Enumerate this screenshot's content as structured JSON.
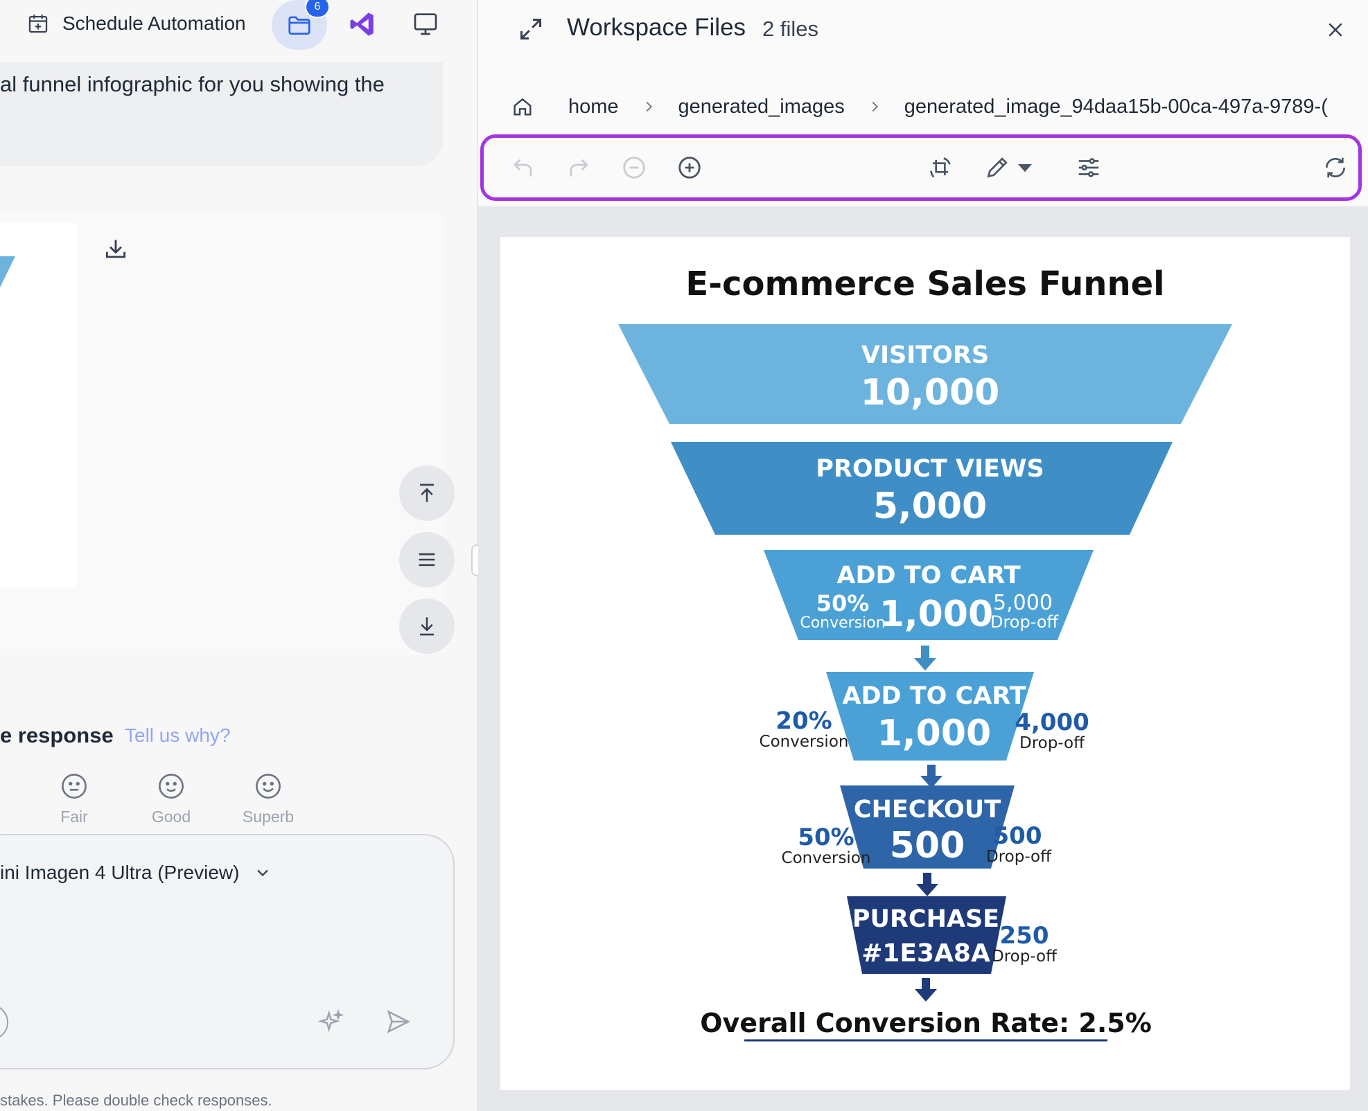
{
  "header": {
    "schedule_label": "Schedule Automation",
    "files_badge": "6"
  },
  "chat": {
    "message_fragment": "al funnel infographic for you showing the",
    "rating": {
      "title_fragment": "e response",
      "tell_us": "Tell us why?",
      "options": [
        "Fair",
        "Good",
        "Superb"
      ]
    },
    "model_label": "ini Imagen 4 Ultra (Preview)",
    "disclaimer": "stakes. Please double check responses."
  },
  "workspace": {
    "title": "Workspace Files",
    "count": "2 files",
    "breadcrumb": [
      "home",
      "generated_images",
      "generated_image_94daa15b-00ca-497a-9789-("
    ]
  },
  "infographic": {
    "title": "E-commerce Sales Funnel",
    "stages": [
      {
        "label": "VISITORS",
        "value": "10,000"
      },
      {
        "label": "PRODUCT VIEWS",
        "value": "5,000"
      },
      {
        "label": "ADD TO CART",
        "value": "1,000",
        "conv_pct": "50%",
        "conv_label": "Conversion",
        "drop_val": "5,000",
        "drop_label": "Drop-off"
      },
      {
        "label": "ADD TO CART",
        "value": "1,000",
        "conv_pct": "20%",
        "conv_label": "Conversion",
        "drop_val": "4,000",
        "drop_label": "Drop-off"
      },
      {
        "label": "CHECKOUT",
        "value": "500",
        "conv_pct": "50%",
        "conv_label": "Conversion",
        "drop_val": "500",
        "drop_label": "Drop-off"
      },
      {
        "label": "PURCHASE",
        "value": "#1E3A8A",
        "drop_val": "250",
        "drop_label": "Drop-off"
      }
    ],
    "footer": "Overall Conversion Rate: 2.5%",
    "colors": {
      "light": "#6cb4de",
      "mid": "#3f8fc6",
      "mid2": "#4ba1d6",
      "dark": "#2d65a8",
      "navy": "#1e3a78",
      "text_blue": "#1f5ba6"
    }
  },
  "icons": {
    "toolbar": [
      "undo-icon",
      "redo-icon",
      "zoom-out-icon",
      "zoom-in-icon",
      "crop-rotate-icon",
      "pencil-icon",
      "caret-down-icon",
      "sliders-icon",
      "reset-icon"
    ]
  }
}
